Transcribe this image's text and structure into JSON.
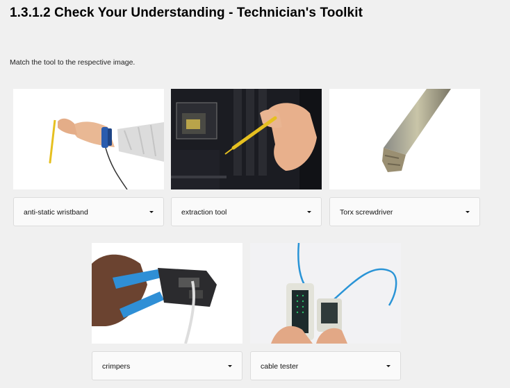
{
  "page": {
    "title": "1.3.1.2 Check Your Understanding - Technician's Toolkit",
    "instruction": "Match the tool to the respective image."
  },
  "items": [
    {
      "image_icon": "antistatic-wristband-photo",
      "selected": "anti-static wristband"
    },
    {
      "image_icon": "extraction-tool-photo",
      "selected": "extraction tool"
    },
    {
      "image_icon": "torx-screwdriver-photo",
      "selected": "Torx screwdriver"
    },
    {
      "image_icon": "crimpers-photo",
      "selected": "crimpers"
    },
    {
      "image_icon": "cable-tester-photo",
      "selected": "cable tester"
    }
  ],
  "colors": {
    "background": "#f0f0f0",
    "dropdown_bg": "#fafafa",
    "dropdown_border": "#dcdcdc",
    "motherboard": "#1b1c22",
    "accent_yellow": "#e6c020",
    "crimper_blue": "#2f8fd6",
    "cable_blue": "#2a94d6"
  }
}
